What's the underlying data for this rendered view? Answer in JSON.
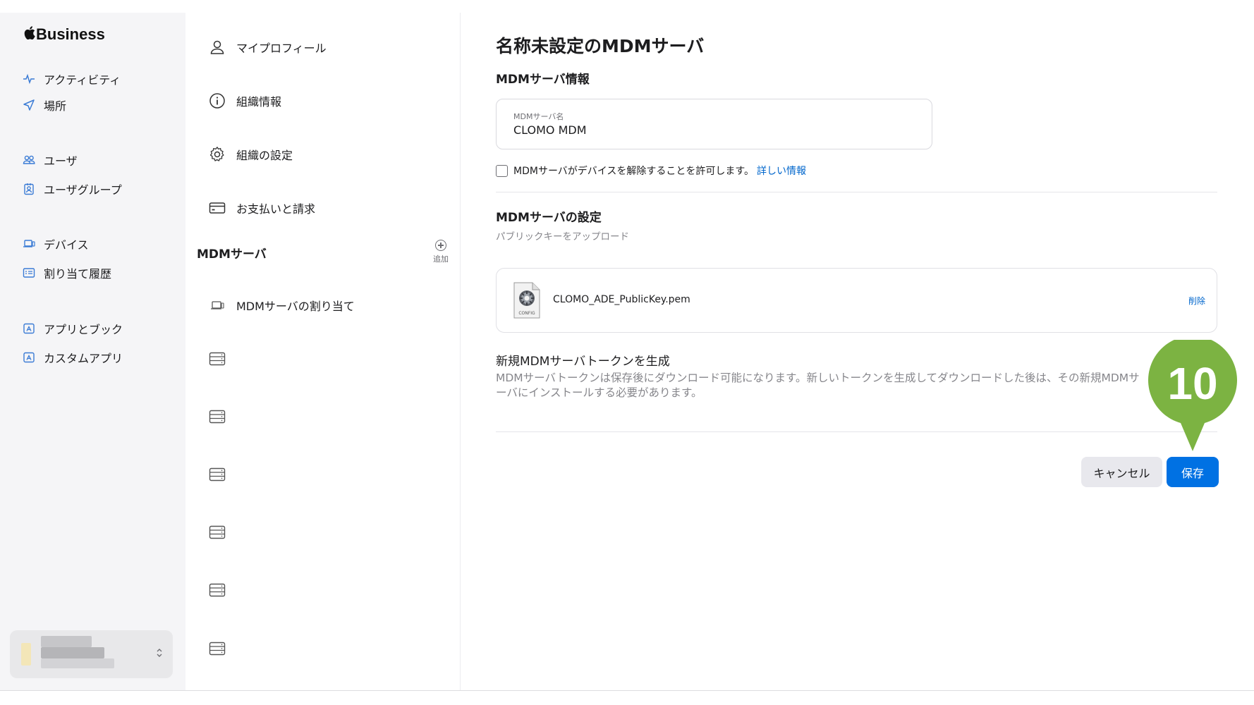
{
  "brand": {
    "apple_glyph": "",
    "name": "Business"
  },
  "sidebar": {
    "items": [
      {
        "label": "アクティビティ",
        "icon": "activity-icon"
      },
      {
        "label": "場所",
        "icon": "location-arrow-icon"
      },
      {
        "label": "ユーザ",
        "icon": "users-icon"
      },
      {
        "label": "ユーザグループ",
        "icon": "user-group-icon"
      },
      {
        "label": "デバイス",
        "icon": "device-laptop-icon"
      },
      {
        "label": "割り当て履歴",
        "icon": "assignment-history-icon"
      },
      {
        "label": "アプリとブック",
        "icon": "app-store-icon"
      },
      {
        "label": "カスタムアプリ",
        "icon": "app-store-icon"
      }
    ],
    "account_chevron": "⌃⌄"
  },
  "settings_menu": {
    "items": [
      {
        "label": "マイプロフィール",
        "icon": "person-icon"
      },
      {
        "label": "組織情報",
        "icon": "info-icon"
      },
      {
        "label": "組織の設定",
        "icon": "gear-icon"
      },
      {
        "label": "お支払いと請求",
        "icon": "credit-card-icon"
      }
    ],
    "mdm_heading": "MDMサーバ",
    "add_label": "追加",
    "assign_label": "MDMサーバの割り当て"
  },
  "main": {
    "title": "名称未設定のMDMサーバ",
    "info_heading": "MDMサーバ情報",
    "name_field_label": "MDMサーバ名",
    "name_field_value": "CLOMO MDM",
    "checkbox_label": "MDMサーバがデバイスを解除することを許可します。",
    "learn_more": "詳しい情報",
    "settings_heading": "MDMサーバの設定",
    "upload_hint": "パブリックキーをアップロード",
    "file_name": "CLOMO_ADE_PublicKey.pem",
    "file_icon_caption": "CONFIG",
    "delete_label": "削除",
    "token_heading": "新規MDMサーバトークンを生成",
    "token_desc": "MDMサーバトークンは保存後にダウンロード可能になります。新しいトークンを生成してダウンロードした後は、その新規MDMサーバにインストールする必要があります。",
    "cancel_label": "キャンセル",
    "save_label": "保存"
  },
  "step_marker": {
    "number": "10",
    "color": "#7cb342"
  },
  "colors": {
    "accent": "#0071e3",
    "link": "#0066cc",
    "sidebar_bg": "#f5f5f7"
  }
}
